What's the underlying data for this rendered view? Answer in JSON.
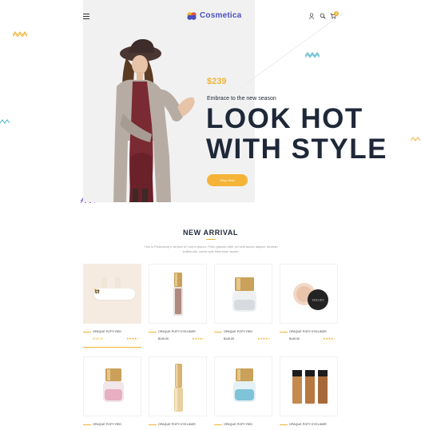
{
  "header": {
    "brand": "Cosmetica",
    "cart_count": "0",
    "menu_icon": "hamburger-menu-icon",
    "user_icon": "user-icon",
    "search_icon": "search-icon",
    "cart_icon": "cart-icon"
  },
  "hero": {
    "price": "$239",
    "tagline": "Embrace to the new season",
    "headline_line1": "LOOK HOT",
    "headline_line2": "WITH STYLE",
    "cta_label": "Shop Now"
  },
  "new_arrival": {
    "title": "NEW ARRIVAL",
    "description": "This is Photoshop's version of Lorem Ipsum. Proin gravida nibh vel velit auctor aliquet. Aenean sollicitudin, lorem quis bibendum auctor."
  },
  "products_row1": [
    {
      "name": "OPAQUE POPY RED",
      "price": "$149.00",
      "stars": "★★★★☆",
      "active": true
    },
    {
      "name": "OPAQUE POPY EYELINER",
      "price": "$149.00",
      "stars": "★★★★☆",
      "active": false
    },
    {
      "name": "OPAQUE POPY RED",
      "price": "$149.00",
      "stars": "★★★★☆",
      "active": false
    },
    {
      "name": "OPAQUE POPY EYELINER",
      "price": "$149.00",
      "stars": "★★★★☆",
      "active": false
    }
  ],
  "products_row2": [
    {
      "name": "OPAQUE POPY RED"
    },
    {
      "name": "OPAQUE POPY EYELINER"
    },
    {
      "name": "OPAQUE POPY RED"
    },
    {
      "name": "OPAQUE POPY EYELINER"
    }
  ],
  "quick_action_icons": [
    "compare-icon",
    "cart-icon",
    "wishlist-heart-icon"
  ],
  "colors": {
    "accent": "#f0b435",
    "brand": "#4a4fbf",
    "heading": "#1f2838"
  }
}
